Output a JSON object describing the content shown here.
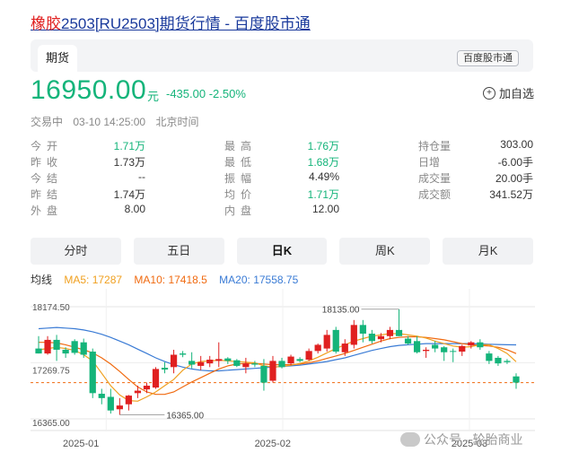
{
  "page": {
    "title_highlight": "橡胶",
    "title_rest": "2503[RU2503]期货行情 - 百度股市通"
  },
  "card": {
    "tab": "期货",
    "source_badge": "百度股市通"
  },
  "price": {
    "current": "16950.00",
    "unit": "元",
    "change": "-435.00",
    "change_pct": "-2.50%",
    "add_watch": "加自选"
  },
  "status": {
    "state": "交易中",
    "time": "03-10 14:25:00",
    "zone": "北京时间"
  },
  "quotes": [
    [
      {
        "label": "今开",
        "value": "1.71万",
        "tone": "green"
      },
      {
        "label": "最高",
        "value": "1.76万",
        "tone": "green"
      },
      {
        "label": "持仓量",
        "value": "303.00",
        "tone": "dark"
      }
    ],
    [
      {
        "label": "昨收",
        "value": "1.73万",
        "tone": "dark"
      },
      {
        "label": "最低",
        "value": "1.68万",
        "tone": "green"
      },
      {
        "label": "日增",
        "value": "-6.00手",
        "tone": "dark"
      }
    ],
    [
      {
        "label": "今结",
        "value": "--",
        "tone": "dark"
      },
      {
        "label": "振幅",
        "value": "4.49%",
        "tone": "dark"
      },
      {
        "label": "成交量",
        "value": "20.00手",
        "tone": "dark"
      }
    ],
    [
      {
        "label": "昨结",
        "value": "1.74万",
        "tone": "dark"
      },
      {
        "label": "均价",
        "value": "1.71万",
        "tone": "green"
      },
      {
        "label": "成交额",
        "value": "341.52万",
        "tone": "dark"
      }
    ],
    [
      {
        "label": "外盘",
        "value": "8.00",
        "tone": "dark"
      },
      {
        "label": "内盘",
        "value": "12.00",
        "tone": "dark"
      },
      {
        "label": "",
        "value": "",
        "tone": "dark"
      }
    ]
  ],
  "periods": [
    {
      "label": "分时",
      "active": false
    },
    {
      "label": "五日",
      "active": false
    },
    {
      "label": "日K",
      "active": true
    },
    {
      "label": "周K",
      "active": false
    },
    {
      "label": "月K",
      "active": false
    }
  ],
  "ma": {
    "label": "均线",
    "ma5": "MA5: 17287",
    "ma10": "MA10: 17418.5",
    "ma20": "MA20: 17558.75",
    "colors": {
      "ma5": "#f0a020",
      "ma10": "#f06a10",
      "ma20": "#3a7bd5",
      "up": "#e02020",
      "down": "#14b47a"
    }
  },
  "chart_data": {
    "type": "candlestick",
    "y_labels": [
      "18174.50",
      "17269.75",
      "16365.00"
    ],
    "y_range": [
      16365.0,
      18174.5
    ],
    "x_labels": [
      "2025-01",
      "2025-02",
      "2025-03"
    ],
    "annotations": {
      "max": "18135.00",
      "min": "16365.00"
    },
    "ref_line": 16950.0,
    "candles": [
      {
        "o": 17500,
        "h": 17700,
        "l": 17420,
        "c": 17420
      },
      {
        "o": 17420,
        "h": 17700,
        "l": 17400,
        "c": 17640
      },
      {
        "o": 17640,
        "h": 17720,
        "l": 17300,
        "c": 17480
      },
      {
        "o": 17480,
        "h": 17520,
        "l": 17350,
        "c": 17420
      },
      {
        "o": 17620,
        "h": 17650,
        "l": 17400,
        "c": 17430
      },
      {
        "o": 17600,
        "h": 17660,
        "l": 17350,
        "c": 17400
      },
      {
        "o": 17450,
        "h": 17500,
        "l": 16700,
        "c": 16780
      },
      {
        "o": 16770,
        "h": 16850,
        "l": 16600,
        "c": 16700
      },
      {
        "o": 16720,
        "h": 16850,
        "l": 16450,
        "c": 16500
      },
      {
        "o": 16520,
        "h": 16700,
        "l": 16430,
        "c": 16580
      },
      {
        "o": 16600,
        "h": 16750,
        "l": 16500,
        "c": 16740
      },
      {
        "o": 16780,
        "h": 16900,
        "l": 16700,
        "c": 16820
      },
      {
        "o": 16840,
        "h": 16950,
        "l": 16780,
        "c": 16900
      },
      {
        "o": 16870,
        "h": 17200,
        "l": 16850,
        "c": 17170
      },
      {
        "o": 17190,
        "h": 17280,
        "l": 17100,
        "c": 17160
      },
      {
        "o": 17200,
        "h": 17480,
        "l": 17100,
        "c": 17400
      },
      {
        "o": 17420,
        "h": 17460,
        "l": 17360,
        "c": 17400
      },
      {
        "o": 17300,
        "h": 17440,
        "l": 17180,
        "c": 17240
      },
      {
        "o": 17220,
        "h": 17380,
        "l": 17150,
        "c": 17280
      },
      {
        "o": 17260,
        "h": 17380,
        "l": 17200,
        "c": 17320
      },
      {
        "o": 17300,
        "h": 17600,
        "l": 17200,
        "c": 17330
      },
      {
        "o": 17340,
        "h": 17360,
        "l": 17250,
        "c": 17300
      },
      {
        "o": 17310,
        "h": 17330,
        "l": 17200,
        "c": 17220
      },
      {
        "o": 17200,
        "h": 17350,
        "l": 17100,
        "c": 17260
      },
      {
        "o": 17260,
        "h": 17300,
        "l": 17200,
        "c": 17240
      },
      {
        "o": 17220,
        "h": 17330,
        "l": 16820,
        "c": 16950
      },
      {
        "o": 16980,
        "h": 17380,
        "l": 16950,
        "c": 17300
      },
      {
        "o": 17300,
        "h": 17350,
        "l": 17180,
        "c": 17200
      },
      {
        "o": 17260,
        "h": 17400,
        "l": 17230,
        "c": 17370
      },
      {
        "o": 17330,
        "h": 17360,
        "l": 17280,
        "c": 17300
      },
      {
        "o": 17320,
        "h": 17500,
        "l": 17300,
        "c": 17460
      },
      {
        "o": 17460,
        "h": 17580,
        "l": 17420,
        "c": 17560
      },
      {
        "o": 17500,
        "h": 17800,
        "l": 17450,
        "c": 17720
      },
      {
        "o": 17800,
        "h": 17850,
        "l": 17420,
        "c": 17450
      },
      {
        "o": 17440,
        "h": 17650,
        "l": 17380,
        "c": 17580
      },
      {
        "o": 17560,
        "h": 17960,
        "l": 17500,
        "c": 17880
      },
      {
        "o": 17880,
        "h": 17960,
        "l": 17600,
        "c": 17740
      },
      {
        "o": 17740,
        "h": 17800,
        "l": 17580,
        "c": 17620
      },
      {
        "o": 17650,
        "h": 17750,
        "l": 17600,
        "c": 17700
      },
      {
        "o": 17700,
        "h": 17850,
        "l": 17650,
        "c": 17800
      },
      {
        "o": 17800,
        "h": 18135,
        "l": 17700,
        "c": 17700
      },
      {
        "o": 17660,
        "h": 17700,
        "l": 17560,
        "c": 17580
      },
      {
        "o": 17620,
        "h": 17700,
        "l": 17420,
        "c": 17440
      },
      {
        "o": 17460,
        "h": 17520,
        "l": 17350,
        "c": 17480
      },
      {
        "o": 17560,
        "h": 17620,
        "l": 17440,
        "c": 17500
      },
      {
        "o": 17520,
        "h": 17540,
        "l": 17300,
        "c": 17440
      },
      {
        "o": 17460,
        "h": 17500,
        "l": 17280,
        "c": 17450
      },
      {
        "o": 17450,
        "h": 17560,
        "l": 17380,
        "c": 17540
      },
      {
        "o": 17550,
        "h": 17620,
        "l": 17500,
        "c": 17600
      },
      {
        "o": 17600,
        "h": 17650,
        "l": 17480,
        "c": 17520
      },
      {
        "o": 17420,
        "h": 17460,
        "l": 17250,
        "c": 17300
      },
      {
        "o": 17350,
        "h": 17380,
        "l": 17220,
        "c": 17260
      },
      {
        "o": 17300,
        "h": 17330,
        "l": 17250,
        "c": 17280
      },
      {
        "o": 17050,
        "h": 17100,
        "l": 16850,
        "c": 16950
      }
    ],
    "ma5": [
      17480,
      17500,
      17520,
      17500,
      17470,
      17400,
      17300,
      17100,
      16900,
      16750,
      16660,
      16650,
      16720,
      16800,
      16900,
      17000,
      17150,
      17250,
      17290,
      17300,
      17310,
      17300,
      17290,
      17280,
      17270,
      17220,
      17200,
      17210,
      17230,
      17260,
      17300,
      17360,
      17430,
      17500,
      17560,
      17620,
      17660,
      17700,
      17720,
      17740,
      17740,
      17720,
      17700,
      17670,
      17620,
      17580,
      17540,
      17520,
      17530,
      17560,
      17560,
      17500,
      17420,
      17287
    ],
    "ma10": [
      17600,
      17600,
      17590,
      17560,
      17520,
      17480,
      17430,
      17350,
      17250,
      17130,
      17000,
      16880,
      16800,
      16760,
      16760,
      16800,
      16880,
      16960,
      17030,
      17100,
      17170,
      17220,
      17250,
      17260,
      17260,
      17250,
      17240,
      17240,
      17240,
      17250,
      17270,
      17300,
      17340,
      17380,
      17420,
      17470,
      17520,
      17570,
      17620,
      17660,
      17680,
      17690,
      17690,
      17680,
      17660,
      17640,
      17610,
      17580,
      17560,
      17550,
      17540,
      17520,
      17480,
      17418.5
    ],
    "ma20": [
      17820,
      17830,
      17840,
      17830,
      17820,
      17800,
      17770,
      17730,
      17680,
      17620,
      17560,
      17490,
      17420,
      17350,
      17290,
      17240,
      17200,
      17170,
      17150,
      17140,
      17140,
      17150,
      17160,
      17170,
      17180,
      17190,
      17200,
      17210,
      17220,
      17230,
      17250,
      17270,
      17290,
      17320,
      17350,
      17390,
      17430,
      17470,
      17500,
      17530,
      17550,
      17560,
      17570,
      17580,
      17580,
      17580,
      17580,
      17580,
      17580,
      17575,
      17570,
      17565,
      17560,
      17558.75
    ]
  },
  "watermark": {
    "text": "公众号 · 轮胎商业"
  }
}
